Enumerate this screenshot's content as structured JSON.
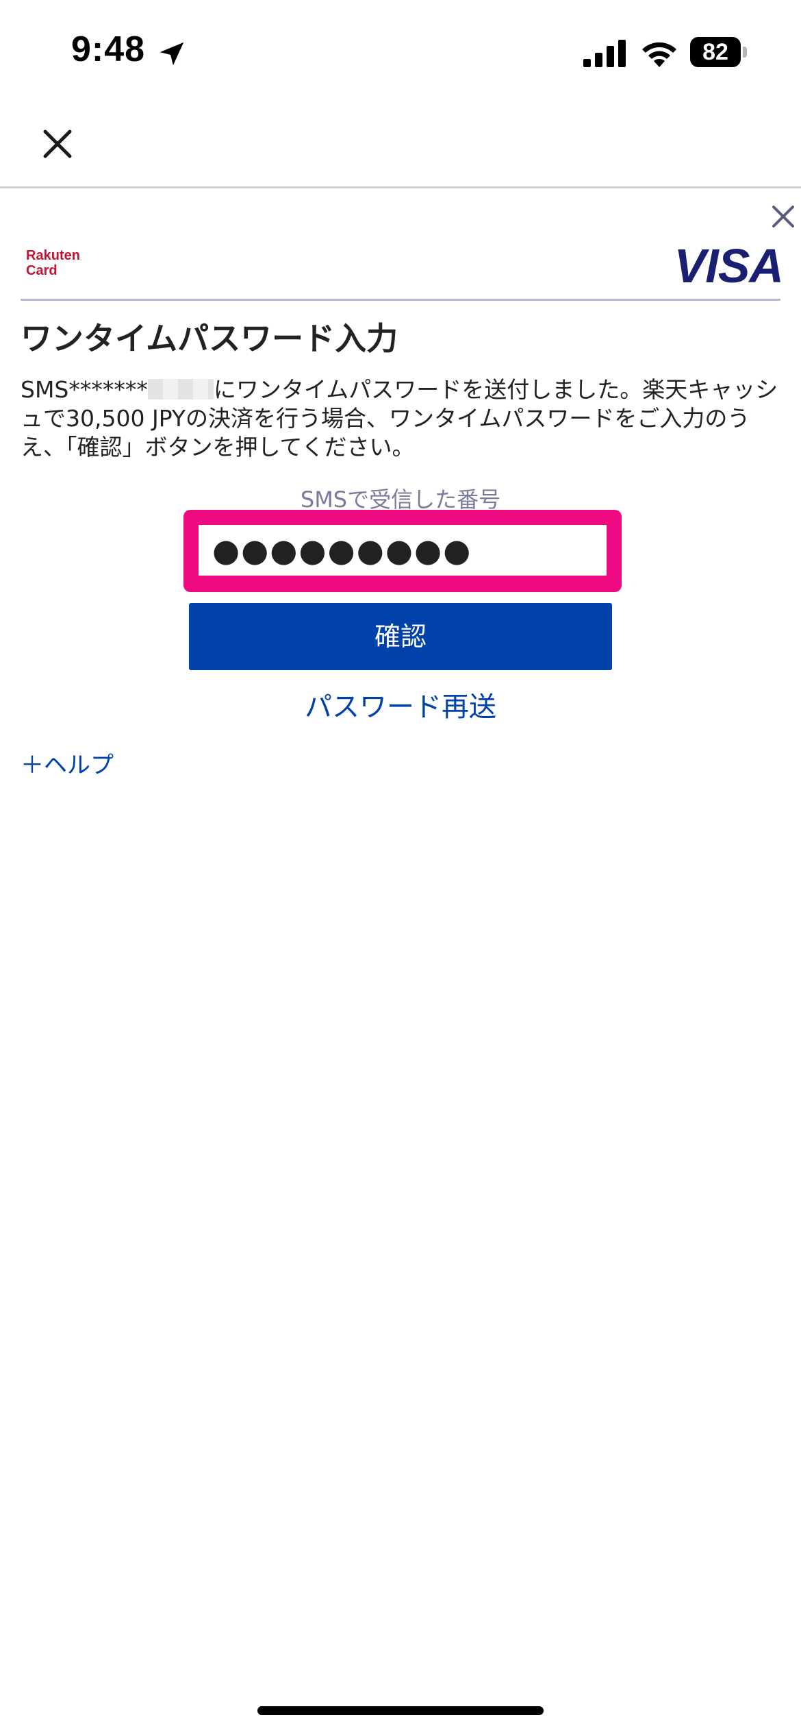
{
  "status_bar": {
    "time": "9:48",
    "battery_level": "82",
    "icons": [
      "location-arrow-icon",
      "cellular-signal-icon",
      "wifi-icon",
      "battery-icon"
    ]
  },
  "nav": {
    "close_icon": "close-icon"
  },
  "auth_frame": {
    "close_icon": "close-icon",
    "issuer_logo_text": "Rakuten Card",
    "network_logo_text": "VISA",
    "title": "ワンタイムパスワード入力",
    "description_prefix": "SMS*******",
    "description_suffix": "にワンタイムパスワードを送付しました。楽天キャッシュで30,500 JPYの決済を行う場合、ワンタイムパスワードをご入力のうえ、「確認」ボタンを押してください。",
    "field_label": "SMSで受信した番号",
    "otp_value": "●●●●●●●●●",
    "confirm_label": "確認",
    "resend_label": "パスワード再送",
    "help_label": "＋ヘルプ"
  },
  "colors": {
    "primary": "#0041aa",
    "highlight": "#ee0a80",
    "rakuten_red": "#c4122f",
    "visa_blue": "#1a1f71"
  }
}
